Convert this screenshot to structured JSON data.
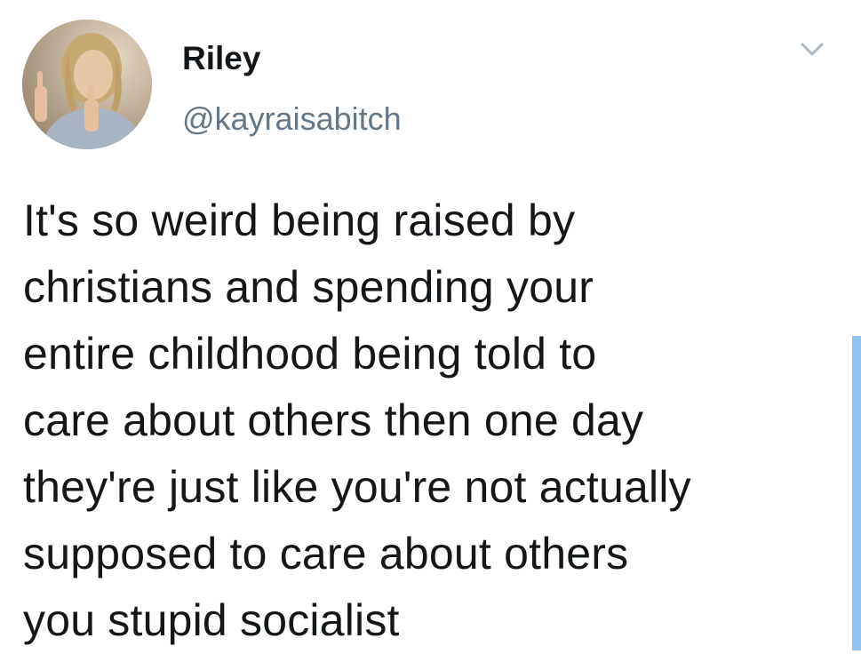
{
  "user": {
    "display_name": "Riley",
    "handle": "@kayraisabitch"
  },
  "tweet": {
    "text": "It's so weird being raised by\nchristians and spending your\nentire childhood being told to\ncare about others then one day\nthey're just like you're not actually\nsupposed to care about others\nyou stupid socialist"
  },
  "icons": {
    "menu": "chevron-down-icon",
    "avatar": "profile-photo"
  },
  "colors": {
    "text": "#14171a",
    "secondary": "#657786",
    "scrollbar": "#8fc3ee"
  }
}
